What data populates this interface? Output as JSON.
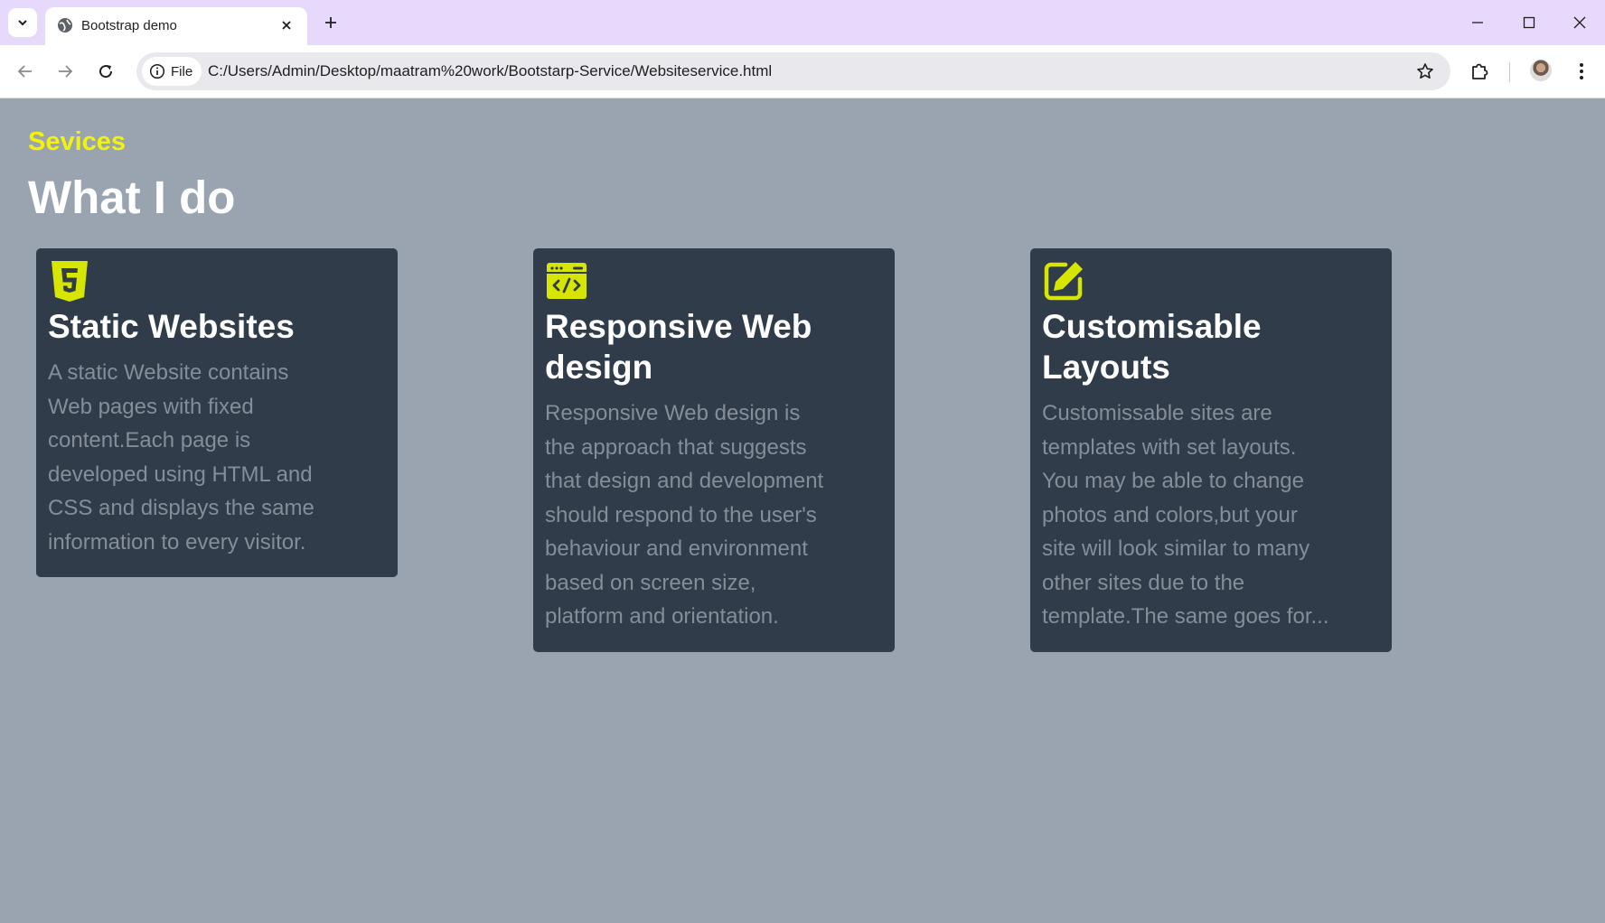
{
  "browser": {
    "tab_title": "Bootstrap demo",
    "chip_label": "File",
    "url": "C:/Users/Admin/Desktop/maatram%20work/Bootstarp-Service/Websiteservice.html"
  },
  "page": {
    "eyebrow": "Sevices",
    "headline": "What I do"
  },
  "cards": [
    {
      "icon": "html5-icon",
      "title": "Static Websites",
      "text": "A static Website contains Web pages with fixed content.Each page is developed using HTML and CSS and displays the same information to every visitor."
    },
    {
      "icon": "code-window-icon",
      "title": "Responsive Web design",
      "text": "Responsive Web design is the approach that suggests that design and development should respond to the user's behaviour and environment based on screen size, platform and orientation."
    },
    {
      "icon": "edit-icon",
      "title": "Customisable Layouts",
      "text": "Customissable sites are templates with set layouts. You may be able to change photos and colors,but your site will look similar to many other sites due to the template.The same goes for..."
    }
  ],
  "colors": {
    "page_background": "#99a4b0",
    "card_background": "#313c4a",
    "accent_yellow": "#f2f20d",
    "icon_yellow": "#d6e600",
    "card_text": "#858e98"
  }
}
